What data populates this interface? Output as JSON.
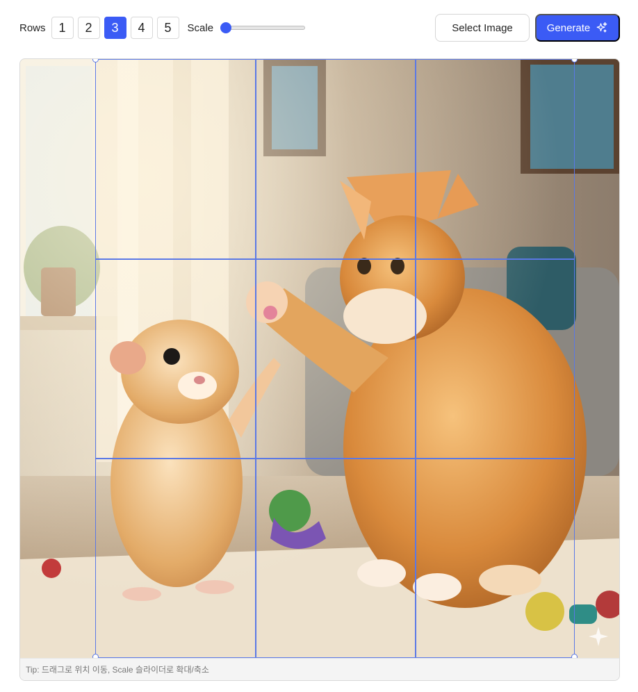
{
  "toolbar": {
    "rows_label": "Rows",
    "row_options": [
      "1",
      "2",
      "3",
      "4",
      "5"
    ],
    "selected_rows": "3",
    "scale_label": "Scale",
    "scale_value": 0,
    "select_image_label": "Select Image",
    "generate_label": "Generate",
    "accent_color": "#3b5bf5"
  },
  "canvas": {
    "image_description": "cat and hamster high-five",
    "grid_rows": 3,
    "grid_cols": 3,
    "grid_color": "#5a78e6",
    "tip": "Tip: 드래그로 위치 이동, Scale 슬라이더로 확대/축소"
  }
}
